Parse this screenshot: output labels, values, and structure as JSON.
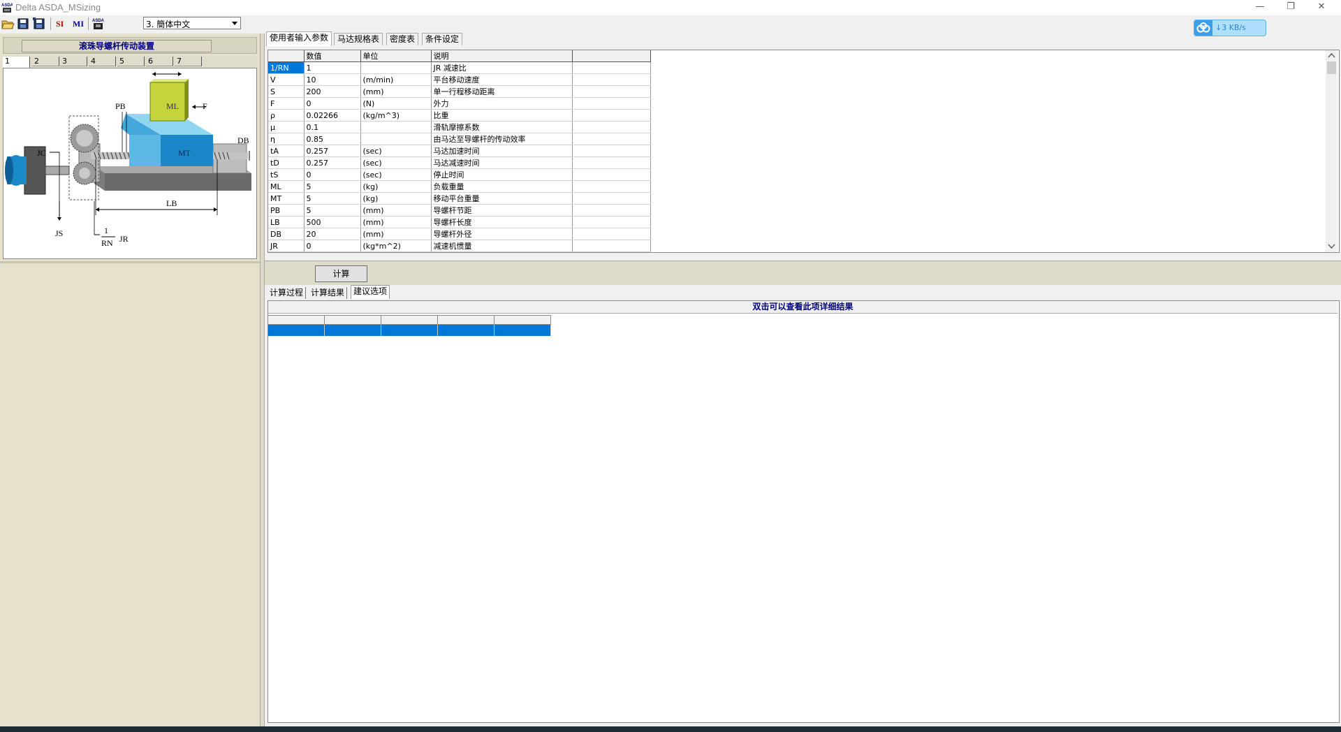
{
  "window": {
    "title": "Delta ASDA_MSizing",
    "minimize": "—",
    "maximize": "❐",
    "close": "✕"
  },
  "toolbar": {
    "si": "SI",
    "mi": "MI",
    "language": "3. 簡体中文"
  },
  "network": {
    "speed": "↓3 KB/s"
  },
  "left": {
    "title": "滚珠导螺杆传动装置",
    "tabs": [
      "1",
      "2",
      "3",
      "4",
      "5",
      "6",
      "7"
    ],
    "diagram_labels": {
      "ml": "ML",
      "mt": "MT",
      "f": "F",
      "pb": "PB",
      "db": "DB",
      "lb": "LB",
      "jc": "JC",
      "js": "JS",
      "jr": "JR",
      "rn_num": "1",
      "rn_den": "RN"
    }
  },
  "upper_tabs": [
    "使用者输入参数",
    "马达规格表",
    "密度表",
    "条件设定"
  ],
  "grid": {
    "headers": [
      "",
      "数值",
      "单位",
      "说明",
      ""
    ],
    "rows": [
      [
        "1/RN",
        "1",
        "",
        "JR 减速比"
      ],
      [
        "V",
        "10",
        "(m/min)",
        "平台移动速度"
      ],
      [
        "S",
        "200",
        "(mm)",
        "单一行程移动距离"
      ],
      [
        "F",
        "0",
        "(N)",
        "外力"
      ],
      [
        "ρ",
        "0.02266",
        "(kg/m^3)",
        "比重"
      ],
      [
        "μ",
        "0.1",
        "",
        "滑轨摩擦系数"
      ],
      [
        "η",
        "0.85",
        "",
        "由马达至导螺杆的传动效率"
      ],
      [
        "tA",
        "0.257",
        "(sec)",
        "马达加速时间"
      ],
      [
        "tD",
        "0.257",
        "(sec)",
        "马达减速时间"
      ],
      [
        "tS",
        "0",
        "(sec)",
        "停止时间"
      ],
      [
        "ML",
        "5",
        "(kg)",
        "负载重量"
      ],
      [
        "MT",
        "5",
        "(kg)",
        "移动平台重量"
      ],
      [
        "PB",
        "5",
        "(mm)",
        "导螺杆节距"
      ],
      [
        "LB",
        "500",
        "(mm)",
        "导螺杆长度"
      ],
      [
        "DB",
        "20",
        "(mm)",
        "导螺杆外径"
      ],
      [
        "JR",
        "0",
        "(kg*m^2)",
        "减速机惯量"
      ]
    ]
  },
  "calc": {
    "button": "计算"
  },
  "lower_tabs": [
    "计算过程",
    "计算结果",
    "建议选项"
  ],
  "result": {
    "header": "双击可以查看此项详细结果"
  }
}
